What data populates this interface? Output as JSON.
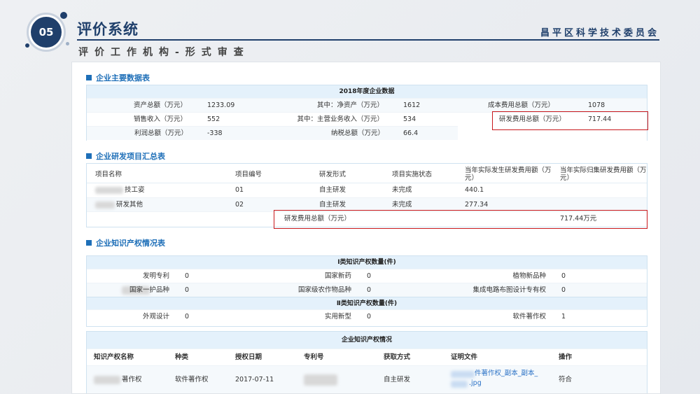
{
  "header": {
    "badge_number": "05",
    "title": "评价系统",
    "organization": "昌平区科学技术委员会",
    "subtitle": "评价工作机构-形式审查"
  },
  "colors": {
    "primary": "#1f3f6b",
    "accent": "#1e6fb8",
    "highlight_border": "#c8181c",
    "table_header": "#e4f1fb"
  },
  "sections": {
    "company_data": {
      "title": "企业主要数据表",
      "table_title": "2018年度企业数据",
      "rows": [
        [
          {
            "label": "资产总额（万元）",
            "value": "1233.09"
          },
          {
            "label": "其中：净资产（万元）",
            "value": "1612"
          },
          {
            "label": "成本费用总额（万元）",
            "value": "1078"
          }
        ],
        [
          {
            "label": "销售收入（万元）",
            "value": "552"
          },
          {
            "label": "其中：主营业务收入（万元）",
            "value": "534"
          },
          {
            "label": "研发费用总额（万元）",
            "value": "717.44"
          }
        ],
        [
          {
            "label": "利润总额（万元）",
            "value": "-338"
          },
          {
            "label": "纳税总额（万元）",
            "value": "66.4"
          }
        ]
      ]
    },
    "rd_projects": {
      "title": "企业研发项目汇总表",
      "headers": [
        "项目名称",
        "项目编号",
        "研发形式",
        "项目实施状态",
        "当年实际发生研发费用额（万元）",
        "当年实际归集研发费用额（万元）"
      ],
      "rows": [
        {
          "name": "技工姿",
          "code": "01",
          "form": "自主研发",
          "status": "未完成",
          "actual": "440.1"
        },
        {
          "name": "研发其他",
          "code": "02",
          "form": "自主研发",
          "status": "未完成",
          "actual": "277.34"
        }
      ],
      "total_label": "研发费用总额（万元）",
      "total_value": "717.44万元"
    },
    "ip": {
      "title": "企业知识产权情况表",
      "class1_title": "Ⅰ类知识产权数量(件)",
      "class1_rows": [
        [
          {
            "label": "发明专利",
            "value": "0"
          },
          {
            "label": "国家新药",
            "value": "0"
          },
          {
            "label": "植物新品种",
            "value": "0"
          }
        ],
        [
          {
            "label": "国家一护品种",
            "value": "0"
          },
          {
            "label": "国家级农作物品种",
            "value": "0"
          },
          {
            "label": "集成电路布图设计专有权",
            "value": "0"
          }
        ]
      ],
      "class2_title": "Ⅱ类知识产权数量(件)",
      "class2_row": [
        {
          "label": "外观设计",
          "value": "0"
        },
        {
          "label": "实用新型",
          "value": "0"
        },
        {
          "label": "软件著作权",
          "value": "1"
        }
      ],
      "detail_title": "企业知识产权情况",
      "detail_headers": [
        "知识产权名称",
        "种类",
        "授权日期",
        "专利号",
        "获取方式",
        "证明文件",
        "操作"
      ],
      "detail_row": {
        "name": "著作权",
        "type": "软件著作权",
        "date": "2017-07-11",
        "method": "自主研发",
        "file_line1": "件著作权_副本_副本_",
        "file_line2": ".jpg",
        "action": "符合"
      }
    }
  }
}
